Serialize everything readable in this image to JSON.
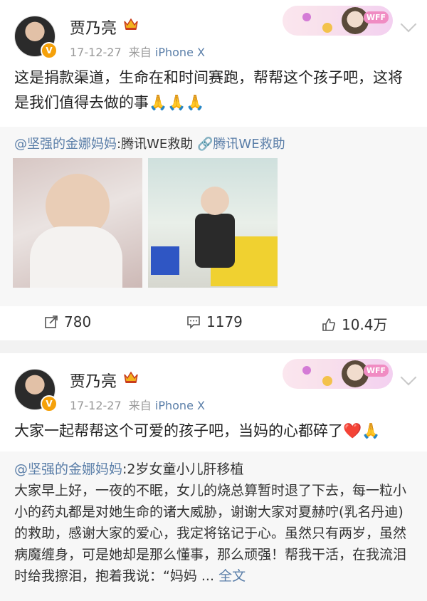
{
  "post1": {
    "author": "贾乃亮",
    "time": "17-12-27",
    "via": "来自",
    "device": "iPhone X",
    "text": "这是捐款渠道，生命在和时间赛跑，帮帮这个孩子吧，这将是我们值得去做的事🙏🙏🙏",
    "repost": {
      "user": "@坚强的金娜妈妈",
      "text": ":腾讯WE救助",
      "link": "🔗腾讯WE救助"
    },
    "actions": {
      "repost_count": "780",
      "comment_count": "1179",
      "like_count": "10.4万"
    }
  },
  "post2": {
    "author": "贾乃亮",
    "time": "17-12-27",
    "via": "来自",
    "device": "iPhone X",
    "text": "大家一起帮帮这个可爱的孩子吧，当妈的心都碎了❤️🙏",
    "repost": {
      "user": "@坚强的金娜妈妈",
      "title": ":2岁女童小儿肝移植",
      "body": "大家早上好，一夜的不眠，女儿的烧总算暂时退了下去，每一粒小小的药丸都是对她生命的诸大威胁，谢谢大家对夏赫咛(乳名丹迪)的救助，感谢大家的爱心，我定将铭记于心。虽然只有两岁，虽然病魔缠身，可是她却是那么懂事，那么顽强！帮我干活，在我流泪时给我擦泪，抱着我说：“妈妈 ...",
      "more": "全文"
    }
  },
  "decor": {
    "badge_text": "WFF"
  },
  "icons": {
    "avatar_badge": "V"
  },
  "colors": {
    "link": "#5a7ea8",
    "meta": "#999999",
    "background": "#f2f2f2"
  }
}
